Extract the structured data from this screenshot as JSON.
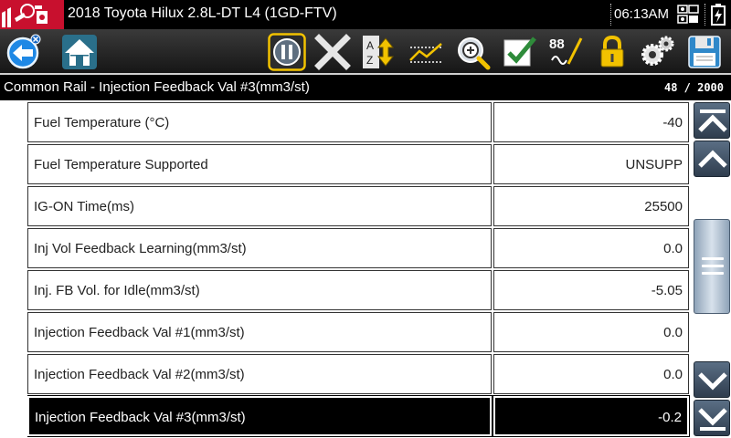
{
  "titlebar": {
    "title": "2018 Toyota Hilux 2.8L-DT L4 (1GD-FTV)",
    "time": "06:13AM"
  },
  "toolbar": {
    "buttons": [
      {
        "name": "back-button",
        "icon": "back-arrow-icon"
      },
      {
        "name": "home-button",
        "icon": "home-icon"
      },
      {
        "name": "pause-button",
        "icon": "pause-icon"
      },
      {
        "name": "exit-button",
        "icon": "close-icon"
      },
      {
        "name": "sort-button",
        "icon": "sort-az-icon"
      },
      {
        "name": "graph-button",
        "icon": "graph-icon"
      },
      {
        "name": "zoom-button",
        "icon": "magnifier-icon"
      },
      {
        "name": "select-button",
        "icon": "checkmark-icon"
      },
      {
        "name": "units-button",
        "icon": "units-88-icon",
        "label": "88"
      },
      {
        "name": "lock-button",
        "icon": "lock-icon"
      },
      {
        "name": "settings-button",
        "icon": "gears-icon"
      },
      {
        "name": "save-button",
        "icon": "floppy-disk-icon"
      }
    ]
  },
  "header": {
    "selected_pid": "Common Rail - Injection Feedback Val #3(mm3/st)",
    "counter": "48 / 2000"
  },
  "rows": [
    {
      "name": "Fuel Temperature (°C)",
      "value": "-40"
    },
    {
      "name": "Fuel Temperature Supported",
      "value": "UNSUPP"
    },
    {
      "name": "IG-ON Time(ms)",
      "value": "25500"
    },
    {
      "name": "Inj Vol Feedback Learning(mm3/st)",
      "value": "0.0"
    },
    {
      "name": "Inj. FB Vol. for Idle(mm3/st)",
      "value": "-5.05"
    },
    {
      "name": "Injection Feedback Val #1(mm3/st)",
      "value": "0.0"
    },
    {
      "name": "Injection Feedback Val #2(mm3/st)",
      "value": "0.0"
    },
    {
      "name": "Injection Feedback Val #3(mm3/st)",
      "value": "-0.2",
      "selected": true
    }
  ],
  "colors": {
    "brand_red": "#c8102e",
    "toolbar_bg": "#222222",
    "highlight_yellow": "#f2c200",
    "scroll_blue": "#3d4f63"
  }
}
